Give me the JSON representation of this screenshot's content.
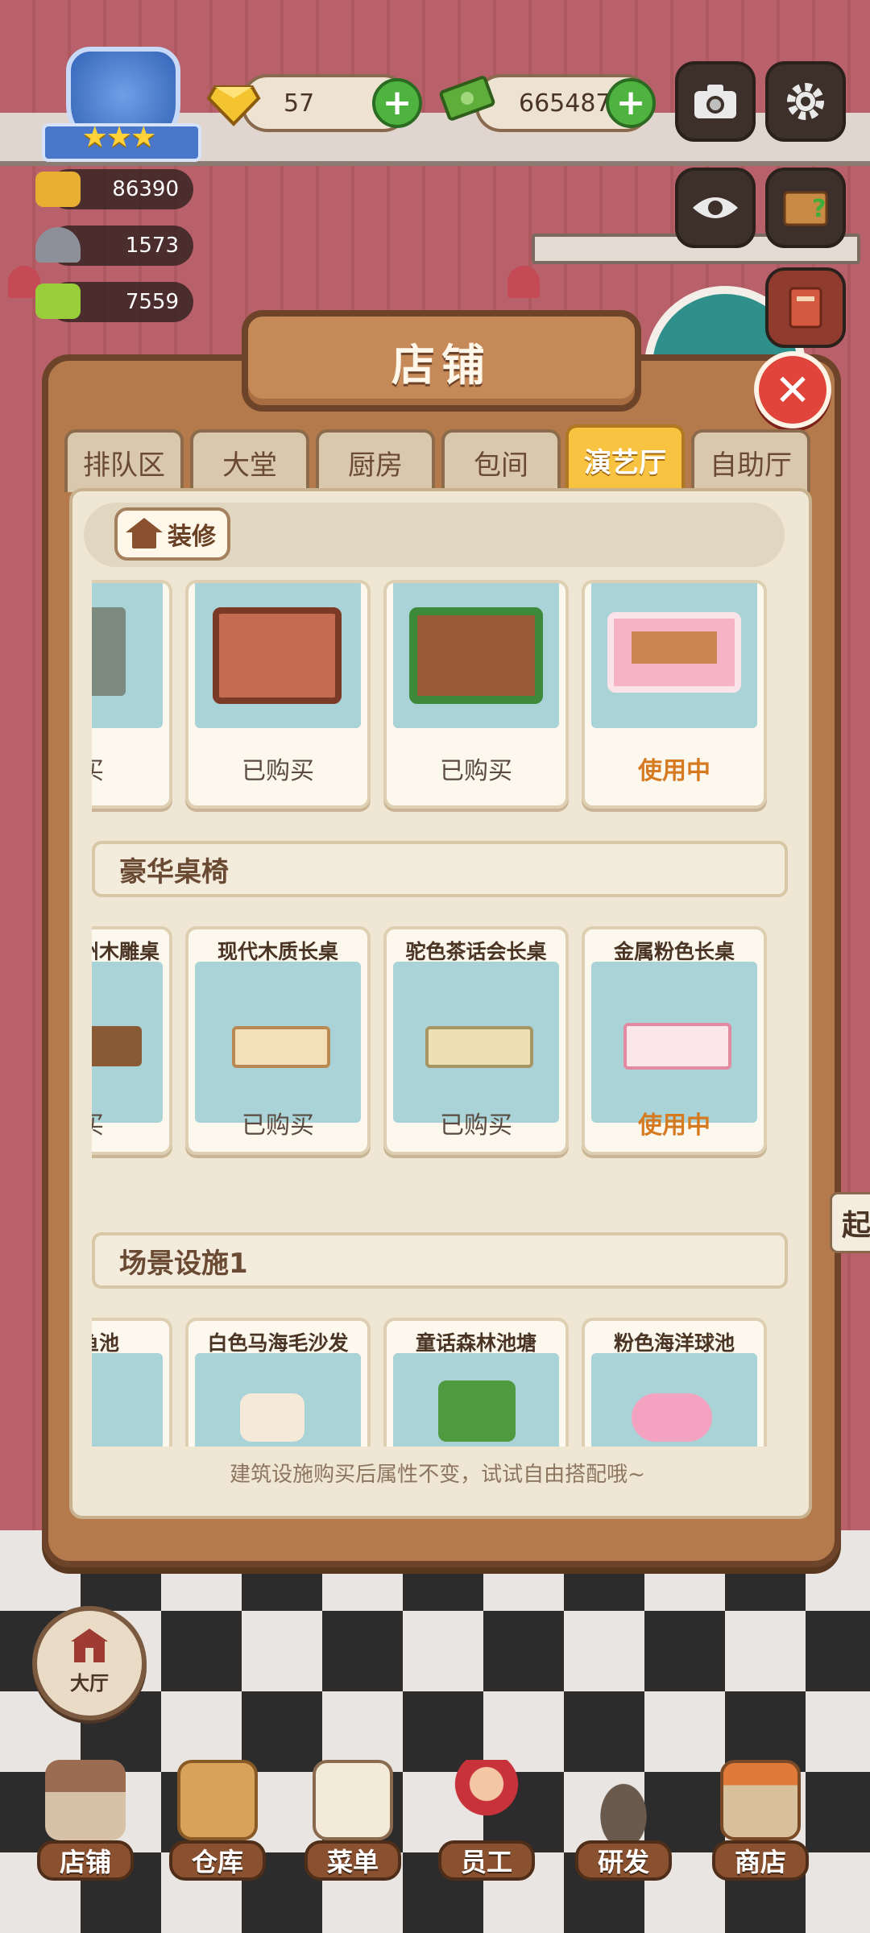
{
  "hud": {
    "gems": "57",
    "cash": "665487",
    "stats": [
      "86390",
      "1573",
      "7559"
    ],
    "rating_stars": "★★★"
  },
  "panel": {
    "title": "店铺",
    "tabs": [
      {
        "label": "排队区",
        "active": false
      },
      {
        "label": "大堂",
        "active": false
      },
      {
        "label": "厨房",
        "active": false
      },
      {
        "label": "包间",
        "active": false
      },
      {
        "label": "演艺厅",
        "active": true
      },
      {
        "label": "自助厅",
        "active": false
      }
    ],
    "decorate_label": "装修",
    "sections": [
      {
        "title": "",
        "cards": [
          {
            "name": "",
            "status": "购买",
            "partial": true
          },
          {
            "name": "",
            "status": "已购买"
          },
          {
            "name": "",
            "status": "已购买"
          },
          {
            "name": "",
            "status": "使用中",
            "in_use": true
          }
        ]
      },
      {
        "title": "豪华桌椅",
        "cards": [
          {
            "name": "州木雕桌",
            "status": "购买",
            "partial": true
          },
          {
            "name": "现代木质长桌",
            "status": "已购买"
          },
          {
            "name": "驼色茶话会长桌",
            "status": "已购买"
          },
          {
            "name": "金属粉色长桌",
            "status": "使用中",
            "in_use": true
          }
        ]
      },
      {
        "title": "场景设施1",
        "cards": [
          {
            "name": "鱼池",
            "partial": true
          },
          {
            "name": "白色马海毛沙发"
          },
          {
            "name": "童话森林池塘"
          },
          {
            "name": "粉色海洋球池"
          }
        ]
      }
    ],
    "hint": "建筑设施购买后属性不变，试试自由搭配哦~"
  },
  "side_label": "起",
  "hall_label": "大厅",
  "nav": [
    {
      "label": "店铺",
      "icon": "shop-building-icon"
    },
    {
      "label": "仓库",
      "icon": "warehouse-boxes-icon"
    },
    {
      "label": "菜单",
      "icon": "menu-clipboard-icon"
    },
    {
      "label": "员工",
      "icon": "staff-chef-icon"
    },
    {
      "label": "研发",
      "icon": "research-pot-icon"
    },
    {
      "label": "商店",
      "icon": "store-front-icon"
    }
  ],
  "colors": {
    "accent_tab": "#f7c341",
    "in_use": "#d67a21",
    "close": "#e0443a",
    "plus": "#4fb33f"
  }
}
